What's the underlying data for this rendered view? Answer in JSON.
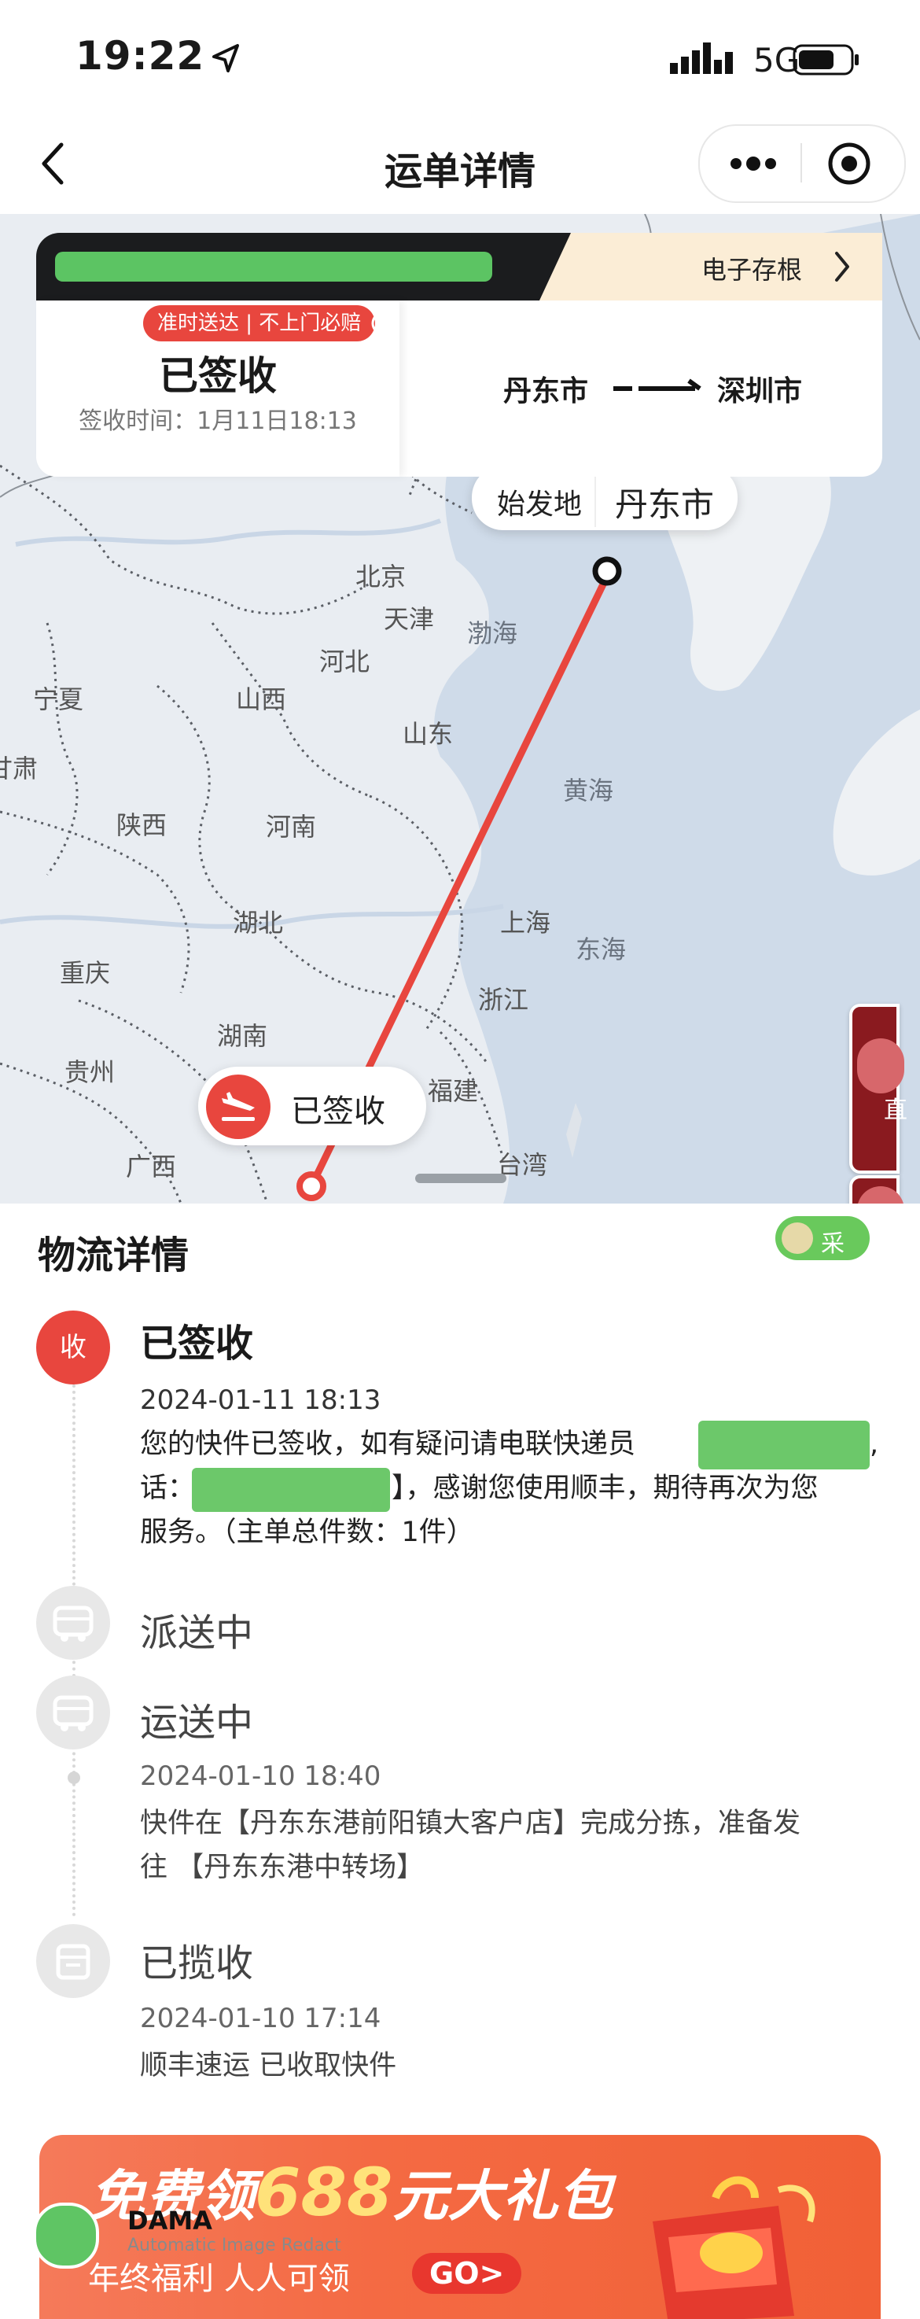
{
  "status_bar": {
    "time": "19:22",
    "network": "5G"
  },
  "nav": {
    "title": "运单详情",
    "more_icon": "more-dots-icon",
    "close_icon": "target-circle-icon"
  },
  "summary": {
    "archive_label": "电子存根",
    "tag": "准时送达 | 不上门必赔",
    "status": "已签收",
    "sign_time": "签收时间：1月11日18:13",
    "from_city": "丹东市",
    "to_city": "深圳市"
  },
  "map": {
    "origin_label": "始发地",
    "origin_city": "丹东市",
    "signed_label": "已签收",
    "place_labels": [
      "北京",
      "天津",
      "河北",
      "山西",
      "山东",
      "宁夏",
      "甘肃",
      "陕西",
      "河南",
      "湖北",
      "重庆",
      "湖南",
      "贵州",
      "广西",
      "福建",
      "浙江",
      "上海",
      "台湾",
      "渤海",
      "黄海",
      "东海"
    ]
  },
  "logistics": {
    "title": "物流详情",
    "steps": [
      {
        "node": "收",
        "title": "已签收",
        "time": "2024-01-11 18:13",
        "desc": [
          "您的快件已签收，如有疑问请电联快递员",
          "话：",
          "】，感谢您使用顺丰，期待再次为您",
          "服务。（主单总件数：1件）"
        ]
      },
      {
        "title": "派送中"
      },
      {
        "title": "运送中",
        "time": "2024-01-10 18:40",
        "desc": [
          "快件在【丹东东港前阳镇大客户店】完成分拣，准备发",
          "往 【丹东东港中转场】"
        ]
      },
      {
        "title": "已揽收",
        "time": "2024-01-10 17:14",
        "desc": [
          "顺丰速运 已收取快件"
        ]
      }
    ]
  },
  "banner": {
    "prefix": "免费领",
    "amount": "688",
    "suffix": "元大礼包",
    "sub": "年终福利 人人可领",
    "go": "GO>"
  },
  "overlay": {
    "dama": "DAMA",
    "watermark": "Automatic Image Redact"
  },
  "colors": {
    "accent_red": "#e8463e",
    "route_red": "#e8463e",
    "redact_green": "#6cc86a"
  }
}
